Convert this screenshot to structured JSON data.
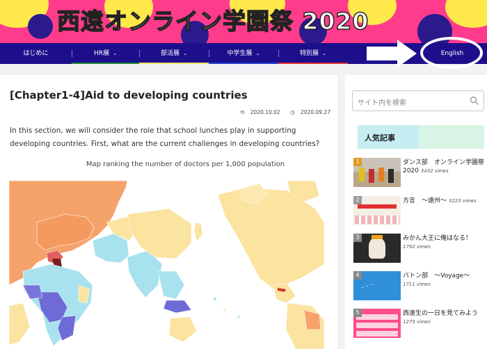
{
  "banner": {
    "title": "西遠オンライン学園祭 2020"
  },
  "nav": {
    "items": [
      {
        "label": "はじめに",
        "has_dropdown": false
      },
      {
        "label": "HR展",
        "has_dropdown": true
      },
      {
        "label": "部活展",
        "has_dropdown": true
      },
      {
        "label": "中学生展",
        "has_dropdown": true
      },
      {
        "label": "特別展",
        "has_dropdown": true
      },
      {
        "label": "English",
        "has_dropdown": false
      }
    ],
    "chevron": "⌄"
  },
  "article": {
    "title": "[Chapter1-4]Aid to developing countries",
    "updated": "2020.10.02",
    "published": "2020.09.27",
    "intro": "In this section, we will consider the role that school lunches play in supporting developing countries. First, what are the current challenges in developing countries?",
    "map_caption": "Map ranking the number of doctors per 1,000 population"
  },
  "sidebar": {
    "search_placeholder": "サイト内を検索",
    "popular_title": "人気記事",
    "popular": [
      {
        "rank": "1",
        "title": "ダンス部　オンライン学園祭2020",
        "views": "3432 views"
      },
      {
        "rank": "2",
        "title": "方言　～遠州～",
        "views": "3223 views"
      },
      {
        "rank": "3",
        "title": "みかん大王に俺はなる！",
        "views": "1792 views"
      },
      {
        "rank": "4",
        "title": "バトン部　～Voyage～",
        "views": "1711 views"
      },
      {
        "rank": "5",
        "title": "西遠生の一日を見てみよう",
        "views": "1275 views"
      }
    ]
  },
  "colors": {
    "navbar": "#1d0f8c",
    "banner": "#ff3c8c",
    "accent": "#3a2ec0"
  }
}
